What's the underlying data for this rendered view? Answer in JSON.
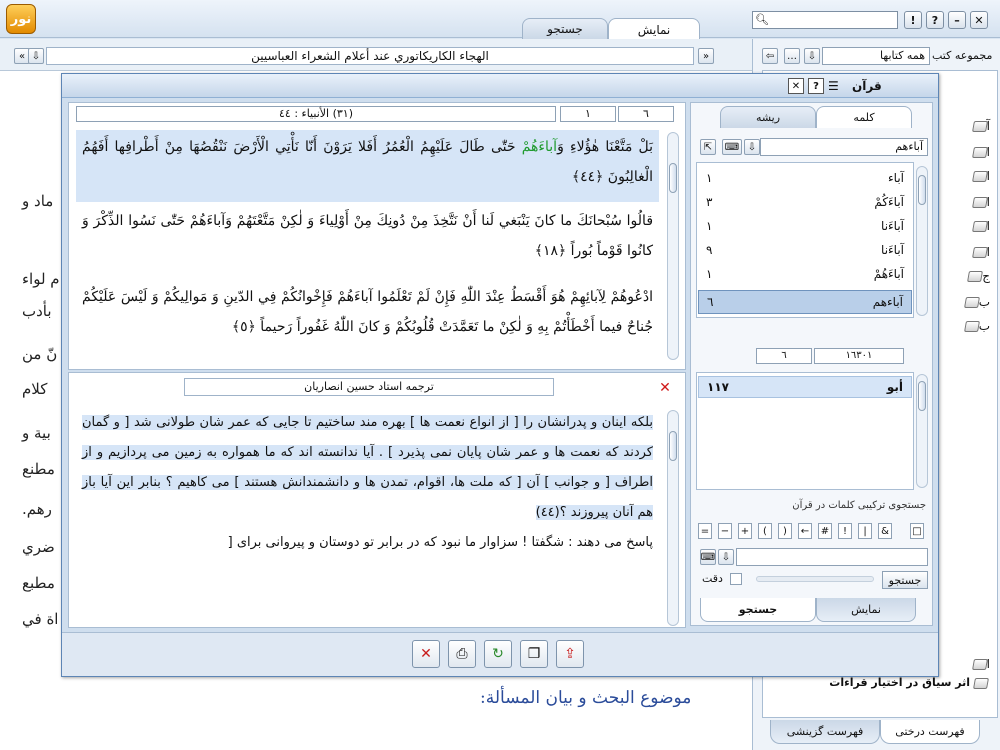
{
  "app": {
    "tabs": [
      {
        "label": "نمایش"
      },
      {
        "label": "جستجو"
      }
    ],
    "doc_title": "الهجاء الكاريكاتوري عند أعلام الشعراء العباسيين",
    "doc_fragments": [
      "ماد و",
      "م لواء",
      "بأدب",
      "نّ من",
      "كلام",
      "بية و",
      "مطنع",
      "رهم.",
      "ضري",
      "مطبع",
      "اة في"
    ],
    "doc_heading": "موضوع البحث و بيان المسألة:"
  },
  "right_panel": {
    "collection_label": "مجموعه کتب",
    "collection_value": "همه کتابها",
    "tree_items": [
      {
        "label": "آ"
      },
      {
        "label": "ا"
      },
      {
        "label": "ا"
      },
      {
        "label": "ا"
      },
      {
        "label": "ا"
      },
      {
        "label": "ا"
      },
      {
        "label": "ج"
      },
      {
        "label": "ب"
      },
      {
        "label": "ب"
      },
      {
        "label": "ا"
      }
    ],
    "tree_last_item": "اثر سیاق در اختیار قراءات",
    "bottom_tabs": [
      {
        "label": "فهرست درختی"
      },
      {
        "label": "فهرست گزینشی"
      }
    ]
  },
  "dialog": {
    "title": "قرآن",
    "quran_ref": "(۳۱) الأنبياء : ٤٤",
    "quran_ref_left": "٦",
    "quran_ref_mid": "١",
    "verses": [
      {
        "pre": "بَلْ مَتَّعْنَا هٰؤُلاءِ وَ",
        "hl": "آباءَهُمْ",
        "post": " حَتّٰى طَالَ عَلَيْهِمُ الْعُمُرُ أَفَلا يَرَوْنَ أَنّا نَأْتِي الْأَرْضَ نَنْقُصُهَا مِنْ أَطْرافِها أَفَهُمُ الْغالِبُونَ ﴿٤٤﴾"
      },
      {
        "pre": "قالُوا سُبْحانَكَ ما كانَ يَنْبَغي لَنا أَنْ نَتَّخِذَ مِنْ دُونِكَ مِنْ أَوْلِياءَ وَ لٰكِنْ مَتَّعْتَهُمْ وَ",
        "hl": "آباءَهُمْ",
        "post": " حَتّٰى نَسُوا الذِّكْرَ وَ كانُوا قَوْماً بُوراً ﴿١٨﴾"
      },
      {
        "pre": "ادْعُوهُمْ لِآبائِهِمْ هُوَ أَقْسَطُ عِنْدَ اللّٰهِ فَإِنْ لَمْ تَعْلَمُوا ",
        "hl": "آباءَهُمْ",
        "post": " فَإِخْوانُكُمْ فِي الدّينِ وَ مَوالِيكُمْ وَ لَيْسَ عَلَيْكُمْ جُناحٌ فيما أَخْطَأْتُمْ بِهِ وَ لٰكِنْ ما تَعَمَّدَتْ قُلُوبُكُمْ وَ كانَ اللّٰهُ غَفُوراً رَحيماً ﴿٥﴾"
      }
    ],
    "translation_title": "ترجمه استاد حسین انصاریان",
    "translation_hl": "بلكه اينان و پدرانشان را [ از انواع نعمت ها ] بهره مند ساختيم تا جايى كه عمر شان طولانى شد [ و گمان كردند كه نعمت ها و عمر شان پايان نمى پذيرد ] . آيا ندانسته اند كه ما همواره به زمين مى پردازيم و از اطراف [ و جوانب ] آن [ كه ملت ها، اقوام، تمدن ها و دانشمندانش هستند ] مى كاهيم ؟ بنابر اين آيا باز هم آنان پيروزند ؟(٤٤)",
    "translation_rest": "پاسخ مى دهند : شگفتا ! سزاوار ما نبود كه در برابر تو دوستان و پيروانى براى ["
  },
  "word_panel": {
    "tabs": [
      {
        "label": "کلمه"
      },
      {
        "label": "ریشه"
      }
    ],
    "search_value": "آباءهم",
    "words": [
      {
        "word": "آباء",
        "count": "١"
      },
      {
        "word": "آباءَکُمْ",
        "count": "٣"
      },
      {
        "word": "آباءَنا",
        "count": "١"
      },
      {
        "word": "آباءَنا",
        "count": "٩"
      },
      {
        "word": "آباءَهُمْ",
        "count": "١"
      },
      {
        "word": "آباءهم",
        "count": "٦"
      }
    ],
    "count_left": "٦",
    "count_right": "١٦٣٠١",
    "root_name": "أبو",
    "root_count": "١١٧",
    "combo_label": "جستجوی ترکیبی کلمات در قرآن",
    "ops": [
      "=",
      "−",
      "+",
      "(",
      ")",
      "←",
      "#",
      "!",
      "|",
      "&",
      "□"
    ],
    "search_btn": "جستجو",
    "precision_label": "دقت",
    "bottom_tabs": [
      {
        "label": "نمایش"
      },
      {
        "label": "جستجو"
      }
    ]
  },
  "colors": {
    "highlight": "#d6e5f7",
    "match_word": "#1f9a2e",
    "verse_marker": "#c41a1a"
  }
}
